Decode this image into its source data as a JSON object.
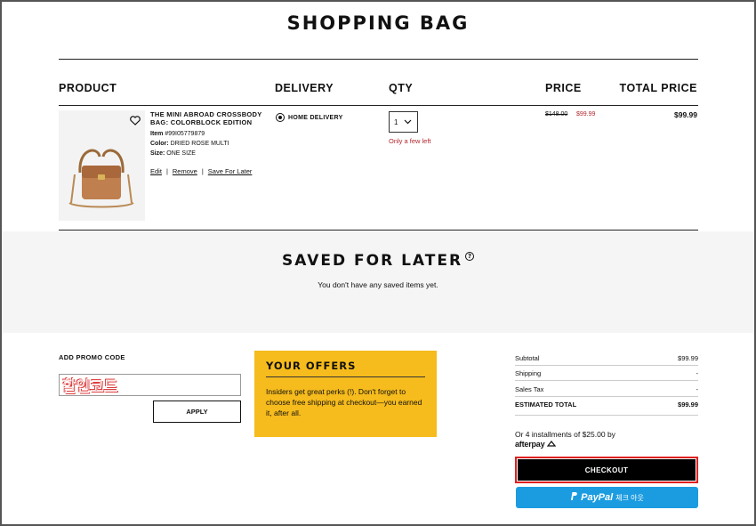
{
  "page": {
    "title": "SHOPPING BAG"
  },
  "columns": [
    "PRODUCT",
    "DELIVERY",
    "QTY",
    "PRICE",
    "TOTAL PRICE"
  ],
  "item": {
    "name": "THE MINI ABROAD CROSSBODY BAG: COLORBLOCK EDITION",
    "item_label": "Item",
    "item_no": "#99I05779879",
    "color_label": "Color:",
    "color": "DRIED ROSE MULTI",
    "size_label": "Size:",
    "size": "ONE SIZE",
    "links": {
      "edit": "Edit",
      "remove": "Remove",
      "save": "Save For Later"
    },
    "delivery": "HOME DELIVERY",
    "qty": "1",
    "stock_note": "Only a few left",
    "price_original": "$148.00",
    "price_sale": "$99.99",
    "total": "$99.99"
  },
  "saved": {
    "title": "SAVED FOR LATER",
    "help_glyph": "?",
    "empty": "You don't have any saved items yet."
  },
  "promo": {
    "label": "ADD PROMO CODE",
    "value": "할인코드",
    "apply": "APPLY"
  },
  "offers": {
    "title": "YOUR OFFERS",
    "body": "Insiders get great perks (!). Don't forget to choose free shipping at checkout—you earned it, after all."
  },
  "summary": {
    "rows": [
      {
        "label": "Subtotal",
        "value": "$99.99"
      },
      {
        "label": "Shipping",
        "value": "-"
      },
      {
        "label": "Sales Tax",
        "value": "-"
      },
      {
        "label": "ESTIMATED TOTAL",
        "value": "$99.99"
      }
    ],
    "installments": "Or 4 installments of $25.00 by",
    "afterpay": "afterpay"
  },
  "buttons": {
    "checkout": "CHECKOUT",
    "paypal": "PayPal",
    "paypal_ko": "체크 아웃"
  },
  "colors": {
    "accent_red": "#b3282d",
    "offers_bg": "#f6bb1c",
    "paypal_blue": "#1c9ce0",
    "highlight": "#e02020"
  }
}
